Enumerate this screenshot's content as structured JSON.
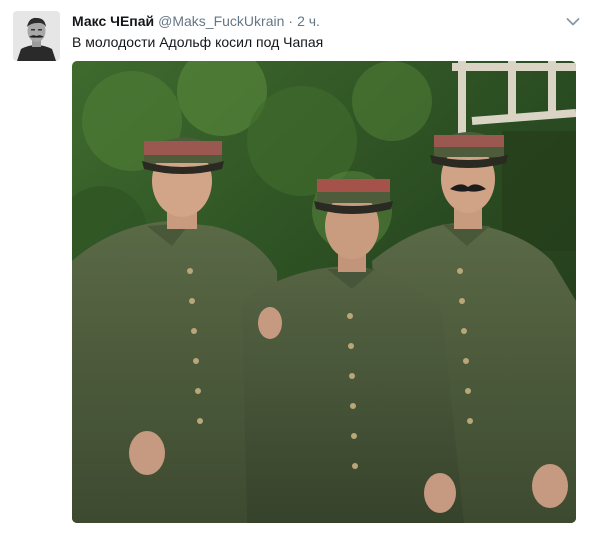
{
  "tweet": {
    "display_name": "Макс ЧЕпай",
    "handle": "@Maks_FuckUkrain",
    "separator": "·",
    "time": "2 ч.",
    "text": "В молодости Адольф косил под Чапая"
  },
  "icons": {
    "caret": "chevron-down-icon",
    "avatar": "user-avatar-photo"
  },
  "colors": {
    "name": "#14171a",
    "meta": "#657786",
    "uniform": "#4a5a38",
    "foliage": "#2f5a26"
  }
}
